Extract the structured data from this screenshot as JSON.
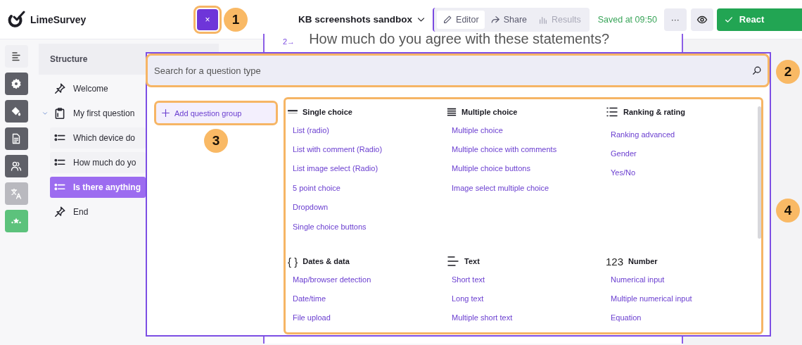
{
  "header": {
    "logo_text": "LimeSurvey",
    "close_button": {
      "label": "×",
      "callout": "1"
    },
    "survey_title": "KB screenshots sandbox",
    "tabs": [
      {
        "label": "Editor",
        "selected": true,
        "disabled": false
      },
      {
        "label": "Share",
        "selected": false,
        "disabled": false
      },
      {
        "label": "Results",
        "selected": false,
        "disabled": true
      }
    ],
    "save_status": "Saved at 09:50",
    "more_button": "···",
    "publish_button": "React"
  },
  "rail": [
    {
      "active": false,
      "disabled": false
    },
    {
      "active": true,
      "disabled": false
    },
    {
      "active": true,
      "disabled": false
    },
    {
      "active": true,
      "disabled": false
    },
    {
      "active": true,
      "disabled": false
    },
    {
      "active": true,
      "disabled": true
    },
    {
      "active": true,
      "disabled": false,
      "color": "#5cc27c"
    }
  ],
  "structure": {
    "title": "Structure",
    "items": [
      {
        "kind": "page",
        "label": "Welcome",
        "selected": false
      },
      {
        "kind": "group",
        "label": "My first question",
        "selected": false,
        "expanded": true,
        "children": [
          {
            "kind": "question",
            "label": "Which device do",
            "selected": false
          },
          {
            "kind": "question",
            "label": "How much do yo",
            "selected": false
          },
          {
            "kind": "question",
            "label": "Is there anything",
            "selected": true
          }
        ]
      },
      {
        "kind": "page",
        "label": "End",
        "selected": false
      }
    ]
  },
  "question": {
    "number": "2→",
    "title": "How much do you agree with these statements?"
  },
  "picker": {
    "search": {
      "placeholder": "Search for a question type",
      "callout": "2"
    },
    "add_group": {
      "label": "Add question group",
      "callout": "3"
    },
    "categories_callout": "4",
    "categories": [
      {
        "kind": "single",
        "title": "Single choice",
        "items": [
          "List (radio)",
          "List with comment (Radio)",
          "List image select (Radio)",
          "5 point choice",
          "Dropdown",
          "Single choice buttons"
        ]
      },
      {
        "kind": "multiple",
        "title": "Multiple choice",
        "items": [
          "Multiple choice",
          "Multiple choice with comments",
          "Multiple choice buttons",
          "Image select multiple choice"
        ]
      },
      {
        "kind": "ranking",
        "title": "Ranking & rating",
        "items": [
          "Ranking advanced",
          "Gender",
          "Yes/No"
        ]
      },
      {
        "kind": "dates",
        "title": "Dates & data",
        "icon_text": "{ }",
        "items": [
          "Map/browser detection",
          "Date/time",
          "File upload"
        ]
      },
      {
        "kind": "text",
        "title": "Text",
        "items": [
          "Short text",
          "Long text",
          "Multiple short text"
        ]
      },
      {
        "kind": "number",
        "title": "Number",
        "icon_text": "123",
        "items": [
          "Numerical input",
          "Multiple numerical input",
          "Equation"
        ]
      }
    ]
  }
}
